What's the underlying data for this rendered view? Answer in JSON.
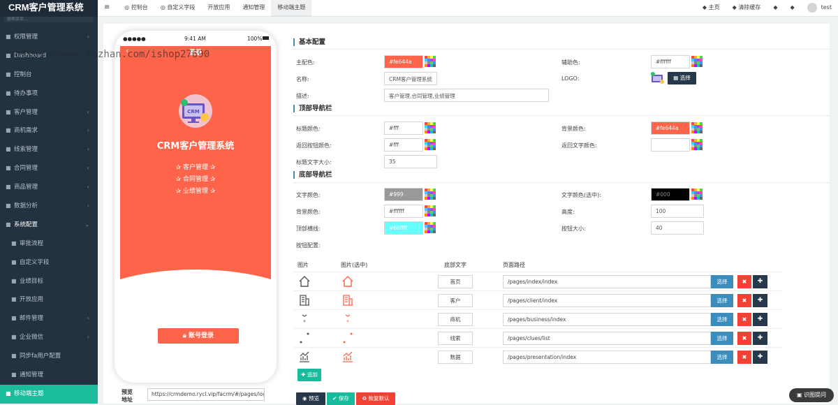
{
  "app_title": "CRM客户管理系统",
  "search_placeholder": "搜索菜单...",
  "sidebar": [
    {
      "icon": "users-icon",
      "label": "权限管理",
      "arrow": "‹",
      "type": "main"
    },
    {
      "icon": "grid-icon",
      "label": "Dashboard",
      "arrow": "",
      "type": "main"
    },
    {
      "icon": "dashboard-icon",
      "label": "控制台",
      "arrow": "",
      "type": "main"
    },
    {
      "icon": "clock-icon",
      "label": "待办事项",
      "arrow": "",
      "type": "main"
    },
    {
      "icon": "user-group-icon",
      "label": "客户管理",
      "arrow": "‹",
      "type": "main"
    },
    {
      "icon": "yen-icon",
      "label": "商机需求",
      "arrow": "‹",
      "type": "main"
    },
    {
      "icon": "signal-icon",
      "label": "线索管理",
      "arrow": "‹",
      "type": "main"
    },
    {
      "icon": "bookmark-icon",
      "label": "合同管理",
      "arrow": "‹",
      "type": "main"
    },
    {
      "icon": "list-icon",
      "label": "商品管理",
      "arrow": "‹",
      "type": "main"
    },
    {
      "icon": "bar-chart-icon",
      "label": "数据分析",
      "arrow": "‹",
      "type": "main"
    },
    {
      "icon": "gears-icon",
      "label": "系统配置",
      "arrow": "⌄",
      "type": "open"
    },
    {
      "icon": "paragraph-icon",
      "label": "审批流程",
      "arrow": "",
      "type": "sub"
    },
    {
      "icon": "circle-icon",
      "label": "自定义字段",
      "arrow": "",
      "type": "sub"
    },
    {
      "icon": "align-icon",
      "label": "业绩目标",
      "arrow": "",
      "type": "sub"
    },
    {
      "icon": "puzzle-icon",
      "label": "开放应用",
      "arrow": "",
      "type": "sub"
    },
    {
      "icon": "table-icon",
      "label": "邮件管理",
      "arrow": "‹",
      "type": "sub"
    },
    {
      "icon": "wechat-icon",
      "label": "企业微信",
      "arrow": "‹",
      "type": "sub"
    },
    {
      "icon": "sync-icon",
      "label": "同步fa用户配置",
      "arrow": "",
      "type": "sub"
    },
    {
      "icon": "bell-icon",
      "label": "通知管理",
      "arrow": "",
      "type": "sub"
    },
    {
      "icon": "mobile-icon",
      "label": "移动端主题",
      "arrow": "",
      "type": "active"
    }
  ],
  "topbar": {
    "tabs": [
      {
        "icon": "dashboard-icon",
        "label": "控制台",
        "active": false
      },
      {
        "icon": "circle-icon",
        "label": "自定义字段",
        "active": false
      },
      {
        "icon": "",
        "label": "开放应用",
        "active": false
      },
      {
        "icon": "",
        "label": "通知管理",
        "active": false
      },
      {
        "icon": "",
        "label": "移动端主题",
        "active": true
      }
    ],
    "right": [
      {
        "icon": "home-icon",
        "label": "主页"
      },
      {
        "icon": "trash-icon",
        "label": "清除缓存"
      },
      {
        "icon": "paint-icon",
        "label": ""
      },
      {
        "icon": "expand-icon",
        "label": ""
      }
    ],
    "user": "test"
  },
  "watermark": "https://www.huzhan.com/ishop27690",
  "phone": {
    "carrier": "●●●●●",
    "time": "9:41 AM",
    "battery": "100%",
    "header": "登录",
    "back": "‹",
    "logo_text": "CRM",
    "title": "CRM客户管理系统",
    "features": [
      "✰ 客户管理 ✰",
      "✰ 合同管理 ✰",
      "✰ 业绩管理 ✰"
    ],
    "login_button": "账号登录"
  },
  "preview": {
    "label": "预览地址",
    "url": "https://crmdemo.rycl.vip/facrm/#/pages/login/l"
  },
  "sections": {
    "basic": "基本配置",
    "topnav": "顶部导航栏",
    "bottomnav": "底部导航栏"
  },
  "fields": {
    "main_color": {
      "label": "主配色:",
      "value": "#fe644a",
      "bg": "#fd644a"
    },
    "aux_color": {
      "label": "辅助色:",
      "value": "#ffffff",
      "bg": "#ffffff"
    },
    "name": {
      "label": "名称:",
      "value": "CRM客户管理系统"
    },
    "logo": {
      "label": "LOGO:",
      "button": "选择"
    },
    "desc": {
      "label": "描述:",
      "value": "客户管理,合同管理,业绩管理"
    },
    "title_color": {
      "label": "标题颜色:",
      "value": "#fff",
      "bg": "#ffffff"
    },
    "bg_color": {
      "label": "背景颜色:",
      "value": "#fe644a",
      "bg": "#fd644a"
    },
    "back_btn_color": {
      "label": "返回按钮颜色:",
      "value": "#fff",
      "bg": "#ffffff"
    },
    "back_text_color": {
      "label": "返回文字颜色:",
      "value": "",
      "bg": "#ffffff"
    },
    "title_size": {
      "label": "标题文字大小:",
      "value": "35"
    },
    "text_color": {
      "label": "文字颜色:",
      "value": "#999",
      "bg": "#999999"
    },
    "text_color_sel": {
      "label": "文字颜色(选中):",
      "value": "#000",
      "bg": "#000000"
    },
    "bottom_bg": {
      "label": "背景颜色:",
      "value": "#ffffff",
      "bg": "#ffffff"
    },
    "height": {
      "label": "高度:",
      "value": "100"
    },
    "top_border": {
      "label": "顶部横线:",
      "value": "#66ffff",
      "bg": "#66ffff"
    },
    "btn_size": {
      "label": "按钮大小:",
      "value": "40"
    },
    "btn_config": {
      "label": "按钮配置:"
    }
  },
  "table": {
    "headers": [
      "图片",
      "图片(选中)",
      "底部文字",
      "页面路径"
    ],
    "rows": [
      {
        "icon": "home-icon",
        "text": "首页",
        "path": "/pages/index/index"
      },
      {
        "icon": "building-icon",
        "text": "客户",
        "path": "/pages/client/index"
      },
      {
        "icon": "money-bag-icon",
        "text": "商机",
        "path": "/pages/business/index"
      },
      {
        "icon": "route-icon",
        "text": "线索",
        "path": "/pages/clues/list"
      },
      {
        "icon": "chart-icon",
        "text": "数据",
        "path": "/pages/presentation/index"
      }
    ],
    "select_label": "选择",
    "delete_label": "✖",
    "add_label": "✚",
    "append_label": "✚ 追加"
  },
  "footer_buttons": {
    "preview": "◉ 预览",
    "save": "✔ 保存",
    "reset": "♻ 恢复默认"
  },
  "help": "识图提问",
  "colors": {
    "accent": "#fd644a",
    "sidebar": "#233240",
    "active": "#1abc9c",
    "primary": "#3c8dbc",
    "danger": "#f34235",
    "dark": "#27384a"
  }
}
